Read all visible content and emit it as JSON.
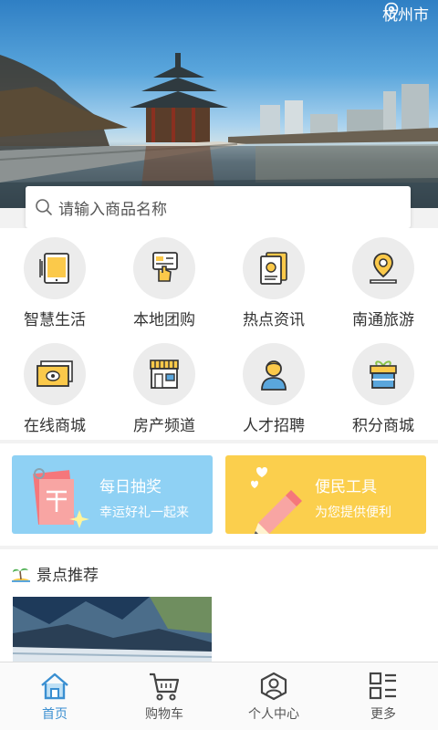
{
  "header": {
    "city": "杭州市",
    "city_icon": "location-pin-icon"
  },
  "search": {
    "placeholder": "请输入商品名称",
    "icon": "search-icon"
  },
  "categories": [
    {
      "label": "智慧生活",
      "icon": "tablet-icon"
    },
    {
      "label": "本地团购",
      "icon": "hand-card-icon"
    },
    {
      "label": "热点资讯",
      "icon": "news-icon"
    },
    {
      "label": "南通旅游",
      "icon": "map-pin-icon"
    },
    {
      "label": "在线商城",
      "icon": "cash-icon"
    },
    {
      "label": "房产频道",
      "icon": "storefront-icon"
    },
    {
      "label": "人才招聘",
      "icon": "person-icon"
    },
    {
      "label": "积分商城",
      "icon": "gift-icon"
    }
  ],
  "promos": [
    {
      "title": "每日抽奖",
      "subtitle": "幸运好礼一起来",
      "color": "#8fd1f4",
      "icon": "lottery-ticket-icon"
    },
    {
      "title": "便民工具",
      "subtitle": "为您提供便利",
      "color": "#fbcf4d",
      "icon": "pencil-icon"
    }
  ],
  "scenic": {
    "title": "景点推荐",
    "icon": "island-icon"
  },
  "tabbar": [
    {
      "label": "首页",
      "icon": "home-icon",
      "active": true
    },
    {
      "label": "购物车",
      "icon": "cart-icon",
      "active": false
    },
    {
      "label": "个人中心",
      "icon": "user-icon",
      "active": false
    },
    {
      "label": "更多",
      "icon": "grid-menu-icon",
      "active": false
    }
  ],
  "colors": {
    "accent": "#3a8fd1",
    "promo_blue": "#8fd1f4",
    "promo_yellow": "#fbcf4d",
    "icon_yellow": "#fbc94a"
  }
}
